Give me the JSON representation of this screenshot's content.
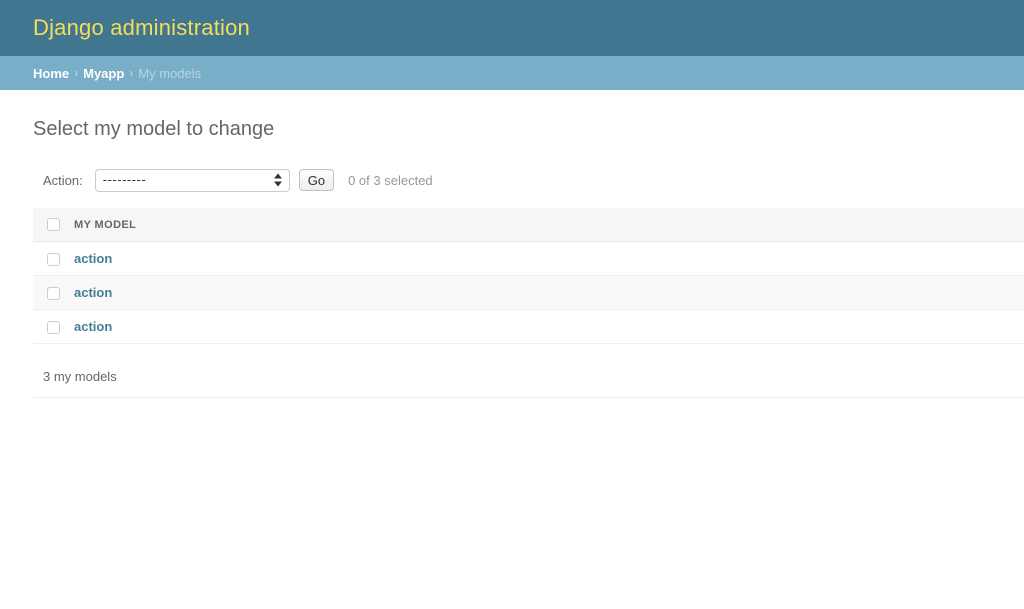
{
  "header": {
    "site_title": "Django administration"
  },
  "breadcrumbs": {
    "separator": "›",
    "items": [
      {
        "label": "Home",
        "current": false
      },
      {
        "label": "Myapp",
        "current": false
      },
      {
        "label": "My models",
        "current": true
      }
    ]
  },
  "content": {
    "title": "Select my model to change"
  },
  "actions": {
    "label": "Action:",
    "select_value": "---------",
    "options": [
      "---------"
    ],
    "go_label": "Go",
    "counter": "0 of 3 selected"
  },
  "table": {
    "columns": [
      "MY MODEL"
    ],
    "rows": [
      {
        "link_label": "action"
      },
      {
        "link_label": "action"
      },
      {
        "link_label": "action"
      }
    ]
  },
  "paginator": {
    "count_text": "3 my models"
  },
  "colors": {
    "header_bg": "#417690",
    "header_text": "#f5dd5d",
    "breadcrumb_bg": "#79aec8",
    "link": "#447e9b",
    "row_alt_bg": "#f9f9f9",
    "table_head_bg": "#f6f6f6"
  }
}
